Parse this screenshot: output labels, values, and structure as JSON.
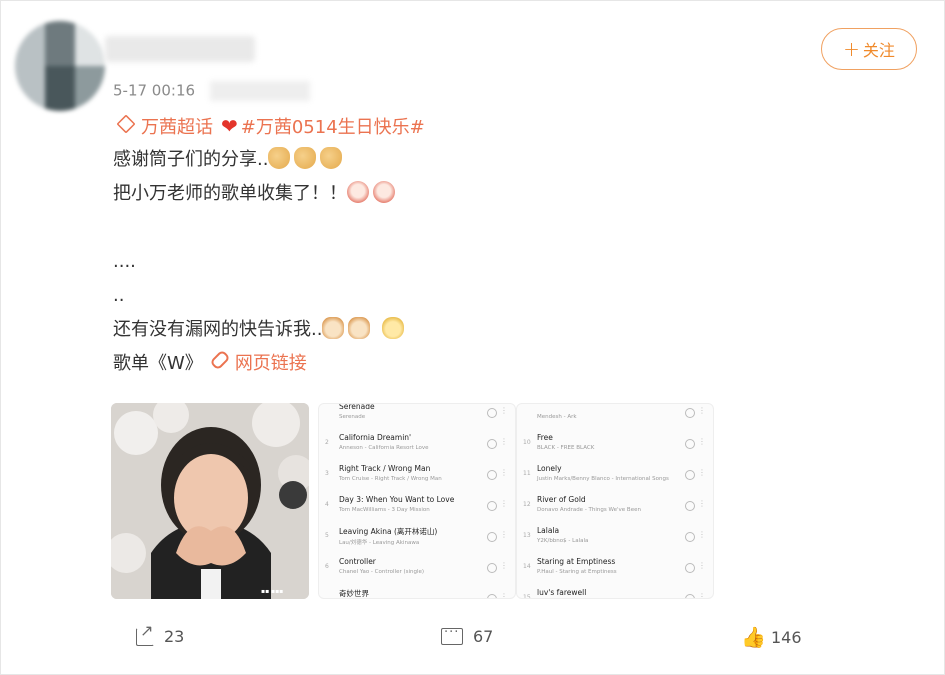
{
  "post": {
    "timestamp": "5-17 00:16",
    "follow_label": "关注",
    "line_topic": {
      "supertopic": "万茜超话",
      "hashtag": "#万茜0514生日快乐#"
    },
    "line1": "感谢筒子们的分享..",
    "line2": "把小万老师的歌单收集了！！",
    "line3": "....",
    "line4": "..",
    "line5": "还有没有漏网的快告诉我..",
    "line6_prefix": "歌单《W》",
    "link_text": "网页链接"
  },
  "images": {
    "list1": [
      {
        "num": "",
        "title": "Serenade",
        "artist": "Serenade"
      },
      {
        "num": "2",
        "title": "California Dreamin'",
        "artist": "Anneson - California Resort Love"
      },
      {
        "num": "3",
        "title": "Right Track / Wrong Man",
        "artist": "Tom Cruise - Right Track / Wrong Man"
      },
      {
        "num": "4",
        "title": "Day 3: When You Want to Love",
        "artist": "Tom MacWilliams - 3 Day Mission"
      },
      {
        "num": "5",
        "title": "Leaving Akina (离开林诺山)",
        "artist": "Lau/刘德华 - Leaving Akinawa"
      },
      {
        "num": "6",
        "title": "Controller",
        "artist": "Chanel Yao - Controller (single)"
      },
      {
        "num": "",
        "title": "奇妙世界",
        "artist": ""
      }
    ],
    "list2": [
      {
        "num": "",
        "title": "",
        "artist": "Mendesh - Ark"
      },
      {
        "num": "10",
        "title": "Free",
        "artist": "BLACK - FREE BLACK"
      },
      {
        "num": "11",
        "title": "Lonely",
        "artist": "Justin Marks/Benny Blanco - International Songs"
      },
      {
        "num": "12",
        "title": "River of Gold",
        "artist": "Donavo Andrade - Things We've Been"
      },
      {
        "num": "13",
        "title": "Lalala",
        "artist": "Y2K/bbno$ - Lalala"
      },
      {
        "num": "14",
        "title": "Staring at Emptiness",
        "artist": "P.Haul - Staring at Emptiness"
      },
      {
        "num": "15",
        "title": "luv's farewell",
        "artist": ""
      }
    ]
  },
  "actions": {
    "repost_count": "23",
    "comment_count": "67",
    "like_count": "146"
  }
}
